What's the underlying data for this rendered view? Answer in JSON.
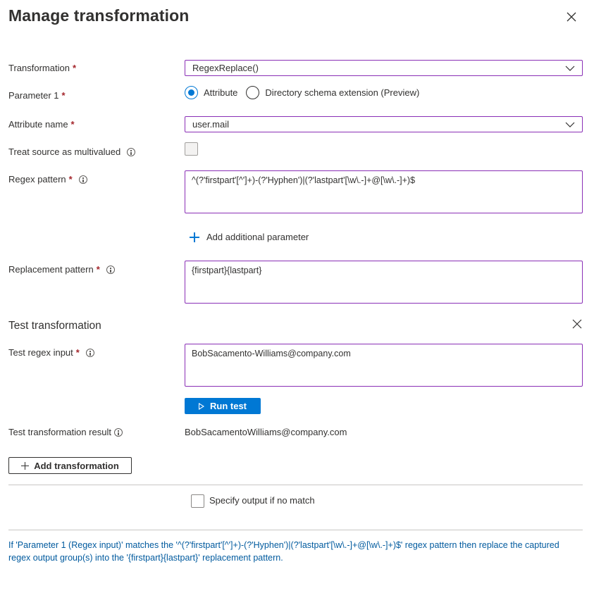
{
  "dialog": {
    "title": "Manage transformation"
  },
  "form": {
    "transformation_label": "Transformation",
    "transformation_value": "RegexReplace()",
    "parameter1_label": "Parameter 1",
    "parameter1_options": [
      "Attribute",
      "Directory schema extension (Preview)"
    ],
    "parameter1_selected": "Attribute",
    "attribute_name_label": "Attribute name",
    "attribute_name_value": "user.mail",
    "multivalued_label": "Treat source as multivalued",
    "multivalued_checked": false,
    "regex_pattern_label": "Regex pattern",
    "regex_pattern_value": "^(?'firstpart'[^']+)-(?'Hyphen')|(?'lastpart'[\\w\\.-]+@[\\w\\.-]+)$",
    "add_parameter_label": "Add additional parameter",
    "replacement_pattern_label": "Replacement pattern",
    "replacement_pattern_value": "{firstpart}{lastpart}"
  },
  "test": {
    "section_title": "Test transformation",
    "input_label": "Test regex input",
    "input_value": "BobSacamento-Williams@company.com",
    "run_button": "Run test",
    "result_label": "Test transformation result",
    "result_value": "BobSacamentoWilliams@company.com"
  },
  "actions": {
    "add_transformation": "Add transformation",
    "no_match_label": "Specify output if no match",
    "no_match_checked": false
  },
  "summary_text": "If 'Parameter 1 (Regex input)' matches the '^(?'firstpart'[^']+)-(?'Hyphen')|(?'lastpart'[\\w\\.-]+@[\\w\\.-]+)$' regex pattern then replace the captured regex output group(s) into the '{firstpart}{lastpart}' replacement pattern.",
  "colors": {
    "accent": "#0078d4",
    "focus_border": "#8a2fb6",
    "required": "#a4262c",
    "summary_text": "#005a9e"
  }
}
